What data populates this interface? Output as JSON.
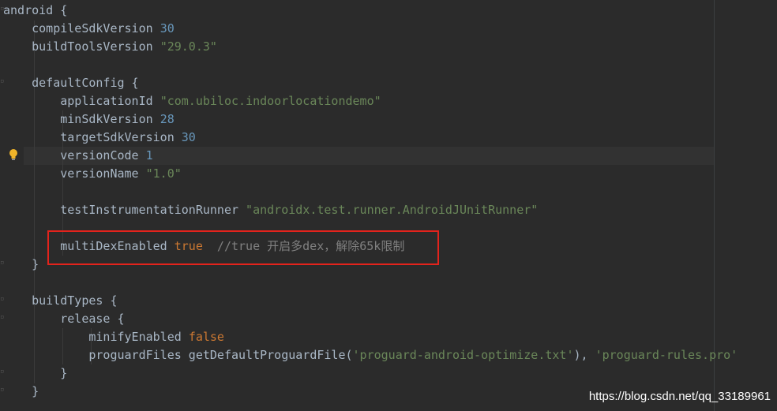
{
  "editor": {
    "lines": [
      {
        "id": "l1",
        "parts": [
          {
            "t": "android {",
            "c": "plain"
          }
        ]
      },
      {
        "id": "l2",
        "parts": [
          {
            "t": "    compileSdkVersion ",
            "c": "plain"
          },
          {
            "t": "30",
            "c": "num"
          }
        ]
      },
      {
        "id": "l3",
        "parts": [
          {
            "t": "    buildToolsVersion ",
            "c": "plain"
          },
          {
            "t": "\"29.0.3\"",
            "c": "str"
          }
        ]
      },
      {
        "id": "l4",
        "parts": []
      },
      {
        "id": "l5",
        "parts": [
          {
            "t": "    defaultConfig {",
            "c": "plain"
          }
        ]
      },
      {
        "id": "l6",
        "parts": [
          {
            "t": "        applicationId ",
            "c": "plain"
          },
          {
            "t": "\"com.ubiloc.indoorlocationdemo\"",
            "c": "str"
          }
        ]
      },
      {
        "id": "l7",
        "parts": [
          {
            "t": "        minSdkVersion ",
            "c": "plain"
          },
          {
            "t": "28",
            "c": "num"
          }
        ]
      },
      {
        "id": "l8",
        "parts": [
          {
            "t": "        targetSdkVersion ",
            "c": "plain"
          },
          {
            "t": "30",
            "c": "num"
          }
        ]
      },
      {
        "id": "l9",
        "parts": [
          {
            "t": "        versionCode ",
            "c": "plain"
          },
          {
            "t": "1",
            "c": "num"
          }
        ]
      },
      {
        "id": "l10",
        "parts": [
          {
            "t": "        versionName ",
            "c": "plain"
          },
          {
            "t": "\"1.0\"",
            "c": "str"
          }
        ]
      },
      {
        "id": "l11",
        "parts": []
      },
      {
        "id": "l12",
        "parts": [
          {
            "t": "        testInstrumentationRunner ",
            "c": "plain"
          },
          {
            "t": "\"androidx.test.runner.AndroidJUnitRunner\"",
            "c": "str"
          }
        ]
      },
      {
        "id": "l13",
        "parts": []
      },
      {
        "id": "l14",
        "parts": [
          {
            "t": "        multiDexEnabled ",
            "c": "plain"
          },
          {
            "t": "true",
            "c": "kw"
          },
          {
            "t": "  //true 开启多dex，解除65k限制",
            "c": "cmt"
          }
        ]
      },
      {
        "id": "l15",
        "parts": [
          {
            "t": "    }",
            "c": "plain"
          }
        ]
      },
      {
        "id": "l16",
        "parts": []
      },
      {
        "id": "l17",
        "parts": [
          {
            "t": "    buildTypes {",
            "c": "plain"
          }
        ]
      },
      {
        "id": "l18",
        "parts": [
          {
            "t": "        release {",
            "c": "plain"
          }
        ]
      },
      {
        "id": "l19",
        "parts": [
          {
            "t": "            minifyEnabled ",
            "c": "plain"
          },
          {
            "t": "false",
            "c": "kw"
          }
        ]
      },
      {
        "id": "l20",
        "parts": [
          {
            "t": "            proguardFiles getDefaultProguardFile(",
            "c": "plain"
          },
          {
            "t": "'proguard-android-optimize.txt'",
            "c": "str"
          },
          {
            "t": "), ",
            "c": "plain"
          },
          {
            "t": "'proguard-rules.pro'",
            "c": "str"
          }
        ]
      },
      {
        "id": "l21",
        "parts": [
          {
            "t": "        }",
            "c": "plain"
          }
        ]
      },
      {
        "id": "l22",
        "parts": [
          {
            "t": "    }",
            "c": "plain"
          }
        ]
      }
    ]
  },
  "watermark": "https://blog.csdn.net/qq_33189961",
  "colors": {
    "background": "#2b2b2b",
    "plain": "#a9b7c6",
    "number": "#6897bb",
    "string": "#6a8759",
    "keyword": "#cc7832",
    "comment": "#808080",
    "highlight_box": "#e3231c"
  }
}
